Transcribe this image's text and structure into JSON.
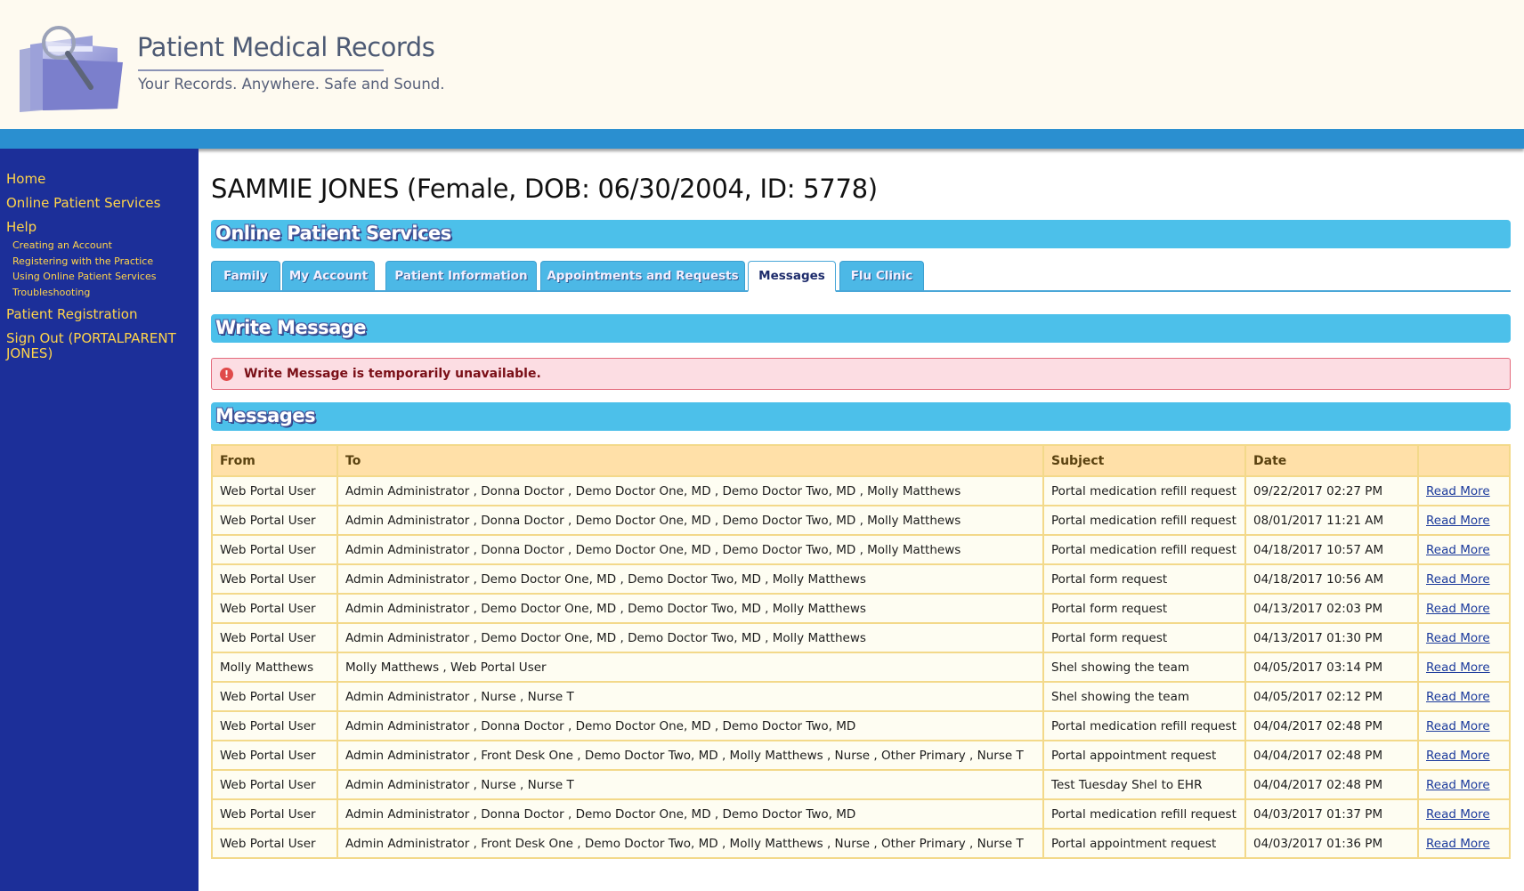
{
  "header": {
    "title": "Patient Medical Records",
    "tagline": "Your Records. Anywhere. Safe and Sound."
  },
  "sidebar": {
    "home": "Home",
    "online_services": "Online Patient Services",
    "help": "Help",
    "help_items": [
      "Creating an Account",
      "Registering with the Practice",
      "Using Online Patient Services",
      "Troubleshooting"
    ],
    "registration": "Patient Registration",
    "signout": "Sign Out (PORTALPARENT JONES)"
  },
  "patient": {
    "heading": "SAMMIE JONES (Female, DOB: 06/30/2004, ID: 5778)"
  },
  "sections": {
    "services": "Online Patient Services",
    "write": "Write Message",
    "messages": "Messages"
  },
  "tabs": [
    "Family",
    "My Account",
    "Patient Information",
    "Appointments and Requests",
    "Messages",
    "Flu Clinic"
  ],
  "active_tab": "Messages",
  "alert": {
    "text": "Write Message is temporarily unavailable.",
    "icon": "exclamation-icon"
  },
  "table": {
    "headers": {
      "from": "From",
      "to": "To",
      "subject": "Subject",
      "date": "Date",
      "action": ""
    },
    "link_label": "Read More",
    "rows": [
      {
        "from": "Web Portal User",
        "to": "Admin Administrator , Donna Doctor , Demo Doctor One, MD , Demo Doctor Two, MD , Molly Matthews",
        "subject": "Portal medication refill request",
        "date": "09/22/2017 02:27 PM"
      },
      {
        "from": "Web Portal User",
        "to": "Admin Administrator , Donna Doctor , Demo Doctor One, MD , Demo Doctor Two, MD , Molly Matthews",
        "subject": "Portal medication refill request",
        "date": "08/01/2017 11:21 AM"
      },
      {
        "from": "Web Portal User",
        "to": "Admin Administrator , Donna Doctor , Demo Doctor One, MD , Demo Doctor Two, MD , Molly Matthews",
        "subject": "Portal medication refill request",
        "date": "04/18/2017 10:57 AM"
      },
      {
        "from": "Web Portal User",
        "to": "Admin Administrator , Demo Doctor One, MD , Demo Doctor Two, MD , Molly Matthews",
        "subject": "Portal form request",
        "date": "04/18/2017 10:56 AM"
      },
      {
        "from": "Web Portal User",
        "to": "Admin Administrator , Demo Doctor One, MD , Demo Doctor Two, MD , Molly Matthews",
        "subject": "Portal form request",
        "date": "04/13/2017 02:03 PM"
      },
      {
        "from": "Web Portal User",
        "to": "Admin Administrator , Demo Doctor One, MD , Demo Doctor Two, MD , Molly Matthews",
        "subject": "Portal form request",
        "date": "04/13/2017 01:30 PM"
      },
      {
        "from": "Molly Matthews",
        "to": "Molly Matthews , Web Portal User",
        "subject": "Shel showing the team",
        "date": "04/05/2017 03:14 PM"
      },
      {
        "from": "Web Portal User",
        "to": "Admin Administrator , Nurse , Nurse T",
        "subject": "Shel showing the team",
        "date": "04/05/2017 02:12 PM"
      },
      {
        "from": "Web Portal User",
        "to": "Admin Administrator , Donna Doctor , Demo Doctor One, MD , Demo Doctor Two, MD",
        "subject": "Portal medication refill request",
        "date": "04/04/2017 02:48 PM"
      },
      {
        "from": "Web Portal User",
        "to": "Admin Administrator , Front Desk One , Demo Doctor Two, MD , Molly Matthews , Nurse , Other Primary , Nurse T",
        "subject": "Portal appointment request",
        "date": "04/04/2017 02:48 PM"
      },
      {
        "from": "Web Portal User",
        "to": "Admin Administrator , Nurse , Nurse T",
        "subject": "Test Tuesday Shel to EHR",
        "date": "04/04/2017 02:48 PM"
      },
      {
        "from": "Web Portal User",
        "to": "Admin Administrator , Donna Doctor , Demo Doctor One, MD , Demo Doctor Two, MD",
        "subject": "Portal medication refill request",
        "date": "04/03/2017 01:37 PM"
      },
      {
        "from": "Web Portal User",
        "to": "Admin Administrator , Front Desk One , Demo Doctor Two, MD , Molly Matthews , Nurse , Other Primary , Nurse T",
        "subject": "Portal appointment request",
        "date": "04/03/2017 01:36 PM"
      }
    ]
  },
  "colors": {
    "header_bg": "#fefaf0",
    "stripe": "#2a8fd0",
    "sidebar_bg": "#1c2f99",
    "sidebar_link": "#ffd44a",
    "section_bar": "#4cc0ea",
    "table_header": "#ffe0a8",
    "alert_bg": "#fcdde3"
  }
}
